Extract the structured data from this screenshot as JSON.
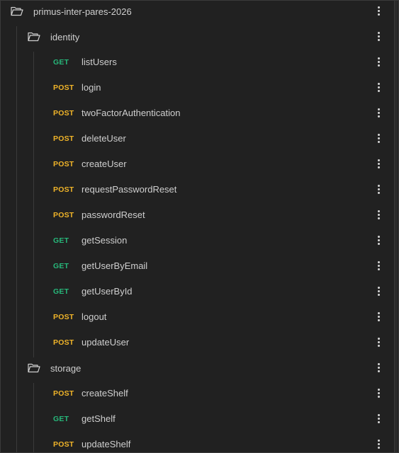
{
  "collection": {
    "name": "primus-inter-pares-2026",
    "icon": "folder-open-icon"
  },
  "folders": [
    {
      "name": "identity",
      "icon": "folder-open-icon",
      "requests": [
        {
          "method": "GET",
          "name": "listUsers"
        },
        {
          "method": "POST",
          "name": "login"
        },
        {
          "method": "POST",
          "name": "twoFactorAuthentication"
        },
        {
          "method": "POST",
          "name": "deleteUser"
        },
        {
          "method": "POST",
          "name": "createUser"
        },
        {
          "method": "POST",
          "name": "requestPasswordReset"
        },
        {
          "method": "POST",
          "name": "passwordReset"
        },
        {
          "method": "GET",
          "name": "getSession"
        },
        {
          "method": "GET",
          "name": "getUserByEmail"
        },
        {
          "method": "GET",
          "name": "getUserById"
        },
        {
          "method": "POST",
          "name": "logout"
        },
        {
          "method": "POST",
          "name": "updateUser"
        }
      ]
    },
    {
      "name": "storage",
      "icon": "folder-open-icon",
      "requests": [
        {
          "method": "POST",
          "name": "createShelf"
        },
        {
          "method": "GET",
          "name": "getShelf"
        },
        {
          "method": "POST",
          "name": "updateShelf"
        }
      ]
    }
  ],
  "colors": {
    "get": "#27b77a",
    "post": "#f0b429",
    "background": "#212121",
    "text": "#cfcfcf"
  }
}
